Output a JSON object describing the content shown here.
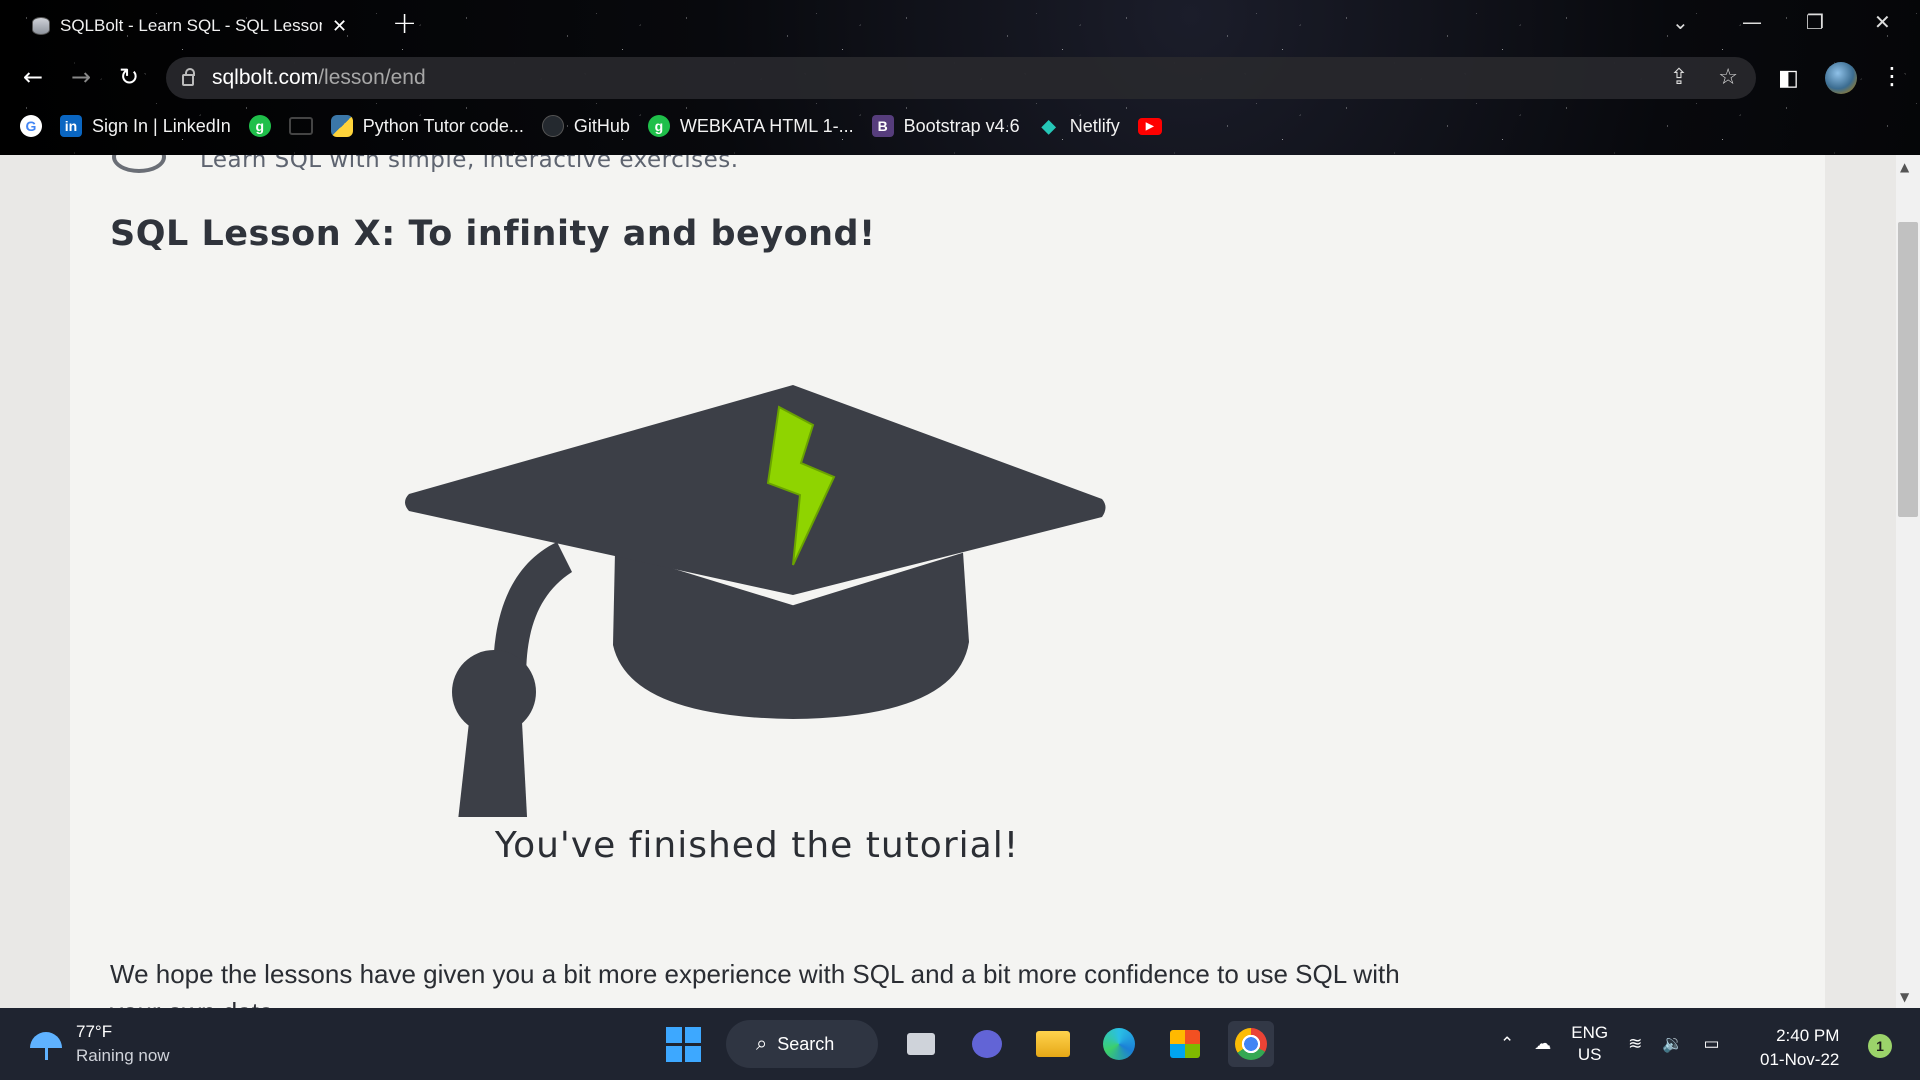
{
  "browser": {
    "tab_title": "SQLBolt - Learn SQL - SQL Lesson",
    "url_host": "sqlbolt.com",
    "url_path": "/lesson/end",
    "bookmarks": [
      {
        "label": "",
        "icon": "google-icon"
      },
      {
        "label": "Sign In | LinkedIn",
        "icon": "linkedin-icon"
      },
      {
        "label": "",
        "icon": "green-badge-icon"
      },
      {
        "label": "",
        "icon": "screen-icon"
      },
      {
        "label": "Python Tutor code...",
        "icon": "python-icon"
      },
      {
        "label": "GitHub",
        "icon": "github-icon"
      },
      {
        "label": "WEBKATA HTML 1-...",
        "icon": "green-badge-icon"
      },
      {
        "label": "Bootstrap v4.6",
        "icon": "bootstrap-icon"
      },
      {
        "label": "Netlify",
        "icon": "netlify-icon"
      },
      {
        "label": "",
        "icon": "youtube-icon"
      }
    ]
  },
  "page": {
    "tagline": "Learn SQL with simple, interactive exercises.",
    "lesson_title": "SQL Lesson X: To infinity and beyond!",
    "finished_text": "You've finished the tutorial!",
    "paragraph": "We hope the lessons have given you a bit more experience with SQL and a bit more confidence to use SQL with your own data."
  },
  "taskbar": {
    "temperature": "77°F",
    "weather": "Raining now",
    "search_label": "Search",
    "lang_line1": "ENG",
    "lang_line2": "US",
    "time": "2:40 PM",
    "date": "01-Nov-22",
    "notifications": "1"
  },
  "colors": {
    "cap": "#3c3f47",
    "bolt": "#8fd400",
    "page_bg": "#f4f4f2"
  }
}
